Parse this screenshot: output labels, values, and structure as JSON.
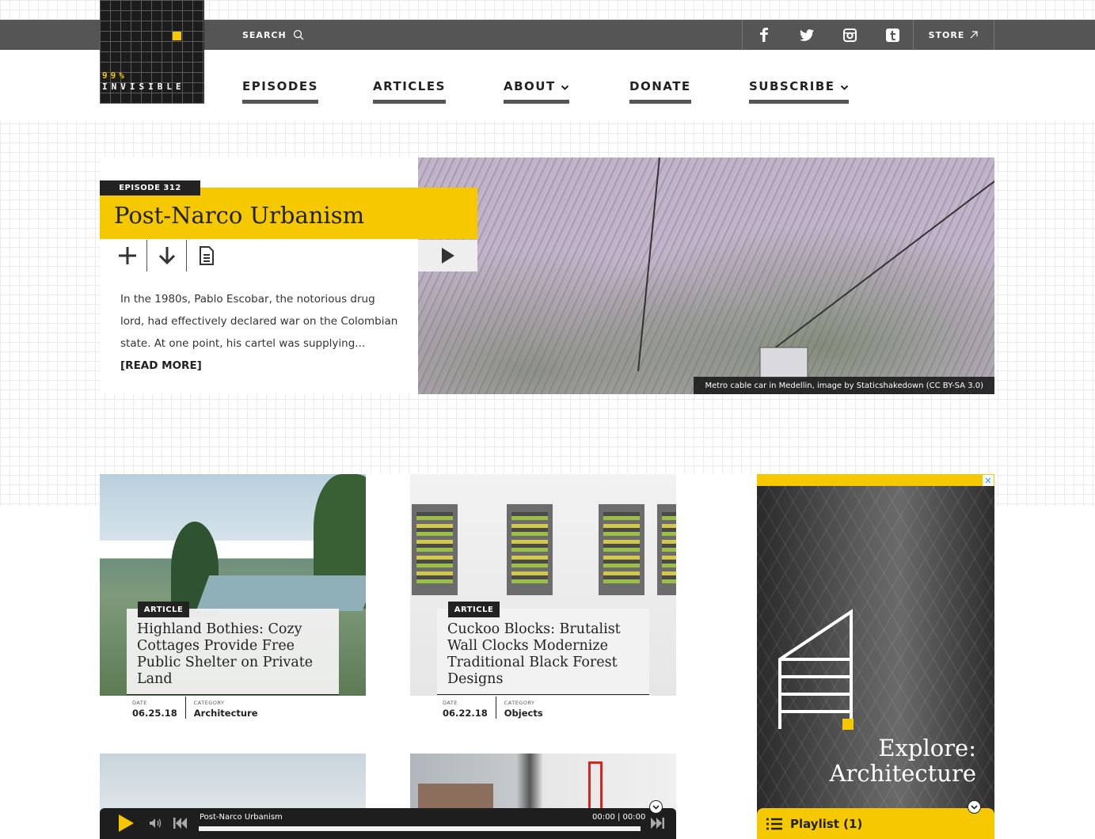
{
  "header": {
    "search_label": "SEARCH",
    "store_label": "STORE",
    "social": [
      "facebook-icon",
      "twitter-icon",
      "instagram-icon",
      "tumblr-icon"
    ]
  },
  "logo": {
    "line1": "99%",
    "line2": "INVISIBLE"
  },
  "nav": {
    "episodes": "EPISODES",
    "articles": "ARTICLES",
    "about": "ABOUT",
    "donate": "DONATE",
    "subscribe": "SUBSCRIBE"
  },
  "hero": {
    "episode_tag": "EPISODE 312",
    "title": "Post-Narco Urbanism",
    "description": "In the 1980s, Pablo Escobar, the notorious drug lord, had effectively declared war on the Colombian state. At one point, his cartel was supplying...",
    "read_more": "[READ MORE]",
    "caption": "Metro cable car in Medellin, image by Staticshakedown (CC BY-SA 3.0)"
  },
  "articles": [
    {
      "tag": "ARTICLE",
      "title": "Highland Bothies: Cozy Cottages Provide Free Public Shelter on Private Land",
      "date_label": "DATE",
      "date": "06.25.18",
      "category_label": "CATEGORY",
      "category": "Architecture"
    },
    {
      "tag": "ARTICLE",
      "title": "Cuckoo Blocks: Brutalist Wall Clocks Modernize Traditional Black Forest Designs",
      "date_label": "DATE",
      "date": "06.22.18",
      "category_label": "CATEGORY",
      "category": "Objects"
    }
  ],
  "ad": {
    "close": "✕",
    "headline": "Explore: Architecture"
  },
  "playlist": {
    "label": "Playlist (1)"
  },
  "player": {
    "title": "Post-Narco Urbanism",
    "time": "00:00 | 00:00",
    "progress": 0
  },
  "colors": {
    "accent": "#f5c800",
    "topbar": "#555555",
    "dark": "#1e1e1e"
  }
}
